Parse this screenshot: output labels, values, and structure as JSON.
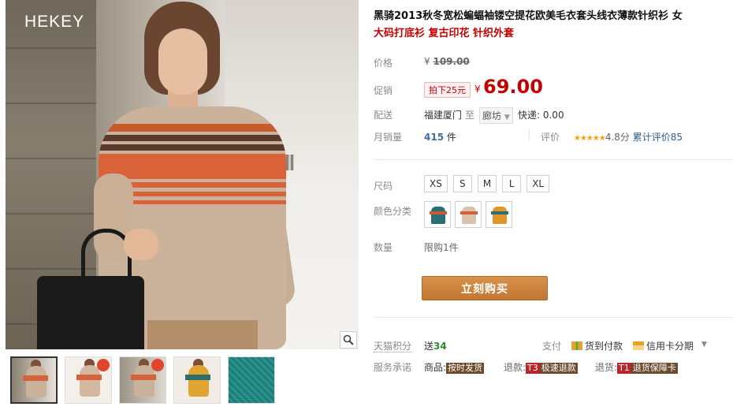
{
  "brand_logo": "HEKEY",
  "product": {
    "title": "黑骑2013秋冬宽松蝙蝠袖镂空提花欧美毛衣套头线衣薄款针织衫 女",
    "subtitle": "大码打底衫 复古印花 针织外套"
  },
  "price": {
    "label": "价格",
    "currency": "¥",
    "original": "109.00"
  },
  "promo": {
    "label": "促销",
    "discount_tag": "拍下25元",
    "currency": "¥",
    "value": "69.00"
  },
  "shipping": {
    "label": "配送",
    "from": "福建厦门",
    "to_word": "至",
    "destination": "廊坊",
    "express": "快递: 0.00"
  },
  "sales": {
    "label": "月销量",
    "count": "415",
    "unit": "件",
    "review_label": "评价",
    "stars": "★★★★★",
    "score": "4.8分",
    "review_link": "累计评价85"
  },
  "size": {
    "label": "尺码",
    "options": [
      "XS",
      "S",
      "M",
      "L",
      "XL"
    ]
  },
  "color": {
    "label": "颜色分类"
  },
  "quantity": {
    "label": "数量",
    "limit": "限购1件"
  },
  "buy_button": "立刻购买",
  "points": {
    "label": "天猫积分",
    "give": "送",
    "amount": "34",
    "pay_label": "支付",
    "cod": "货到付款",
    "installment": "信用卡分期"
  },
  "service": {
    "label": "服务承诺",
    "goods_prefix": "商品:",
    "goods_badge": "按时发货",
    "refund_prefix": "退款:",
    "refund_code": "T3",
    "refund_badge": "极速退款",
    "return_prefix": "退货:",
    "return_code": "T1",
    "return_badge": "退货保障卡"
  },
  "colors": {
    "price_red": "#c40000",
    "buy_button": "#c98038",
    "link_blue": "#2f5c8f"
  },
  "icons": {
    "zoom": "magnifier-icon",
    "ship_caret": "chevron-down-icon",
    "cod": "gift-box-icon",
    "installment": "credit-card-icon",
    "pay_caret": "triangle-down-icon"
  }
}
